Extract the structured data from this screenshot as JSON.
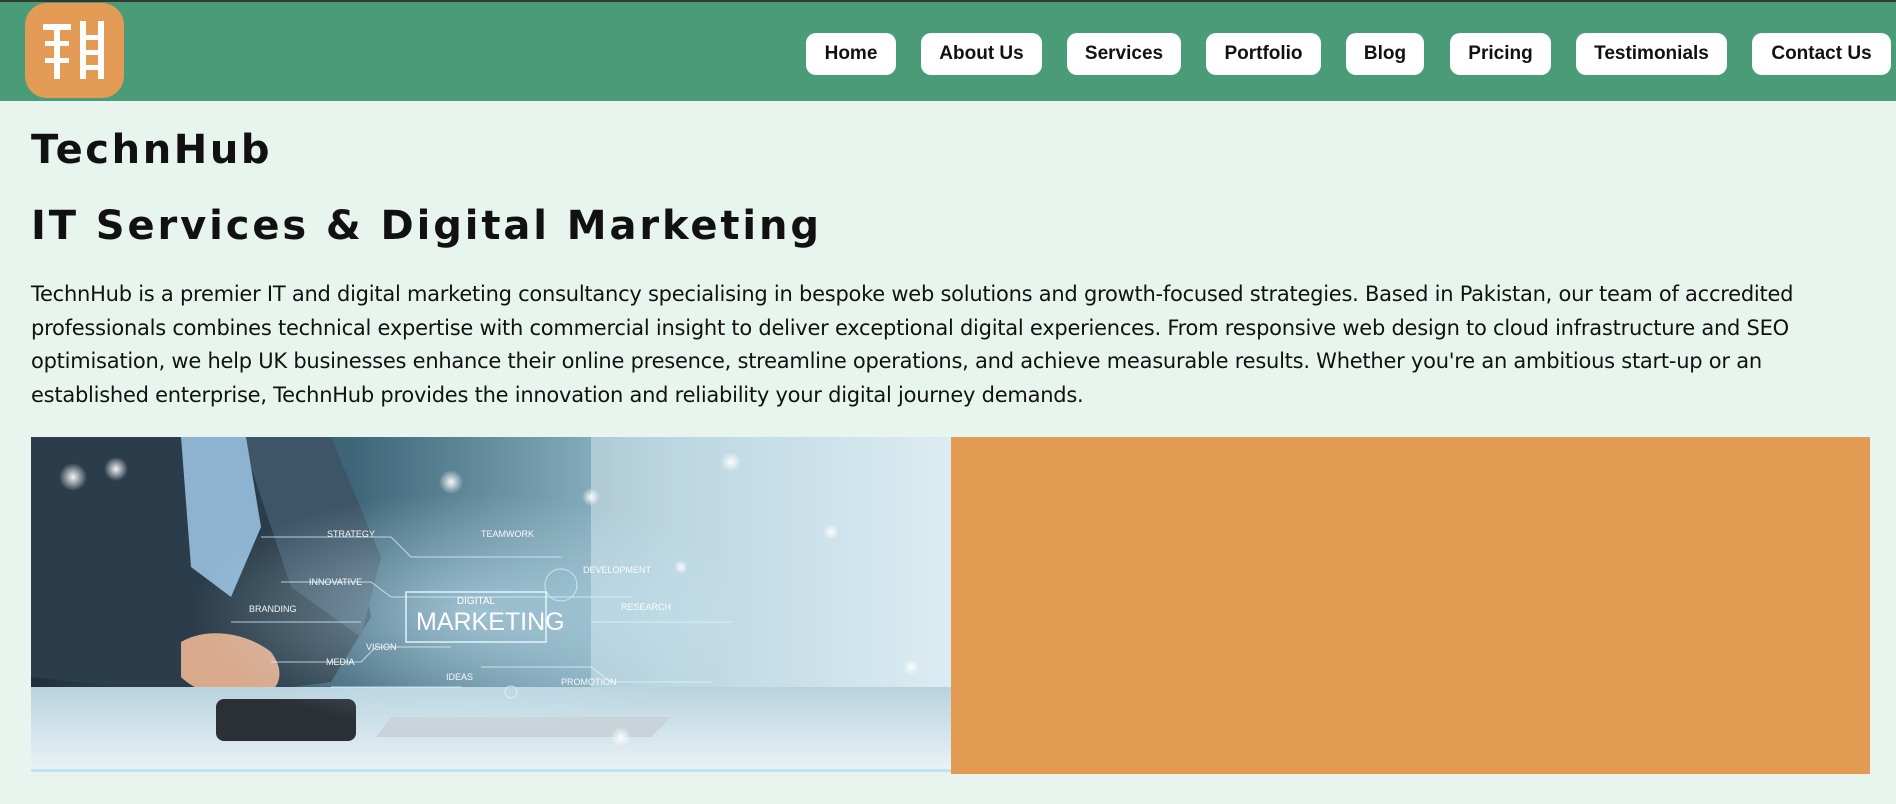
{
  "brand": {
    "logo_name": "technhub-logo",
    "logo_color": "#e39b55"
  },
  "nav": {
    "items": [
      {
        "label": "Home"
      },
      {
        "label": "About Us"
      },
      {
        "label": "Services"
      },
      {
        "label": "Portfolio"
      },
      {
        "label": "Blog"
      },
      {
        "label": "Pricing"
      },
      {
        "label": "Testimonials"
      },
      {
        "label": "Contact Us"
      }
    ],
    "bar_color": "#4a9b78"
  },
  "main": {
    "title": "TechnHub",
    "headline": "IT Services & Digital Marketing",
    "intro": "TechnHub is a premier IT and digital marketing consultancy specialising in bespoke web solutions and growth-focused strategies. Based in Pakistan, our team of accredited professionals combines technical expertise with commercial insight to deliver exceptional digital experiences. From responsive web design to cloud infrastructure and SEO optimisation, we help UK businesses enhance their online presence, streamline operations, and achieve measurable results. Whether you're an ambitious start-up or an established enterprise, TechnHub provides the innovation and reliability your digital journey demands."
  },
  "hero": {
    "overlay": {
      "label_main": "MARKETING",
      "label_top": "DIGITAL",
      "tags": [
        "STRATEGY",
        "TEAMWORK",
        "INNOVATIVE",
        "DEVELOPMENT",
        "BRANDING",
        "RESEARCH",
        "VISION",
        "MEDIA",
        "IDEAS",
        "PROMOTION"
      ]
    },
    "panel_color": "#e39a53"
  },
  "colors": {
    "page_background": "#e8f5ef",
    "text": "#111111"
  }
}
